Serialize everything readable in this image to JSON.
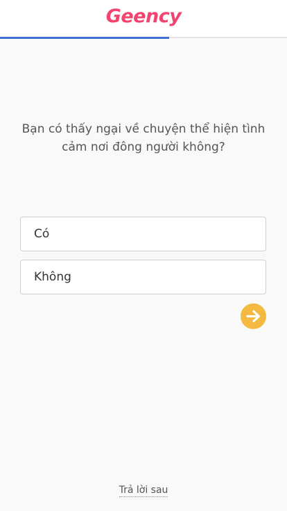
{
  "header": {
    "logo_text": "Geency",
    "progress_fraction": 0.59
  },
  "question": {
    "text": "Bạn có thấy ngại về chuyện thể hiện tình cảm nơi đông người không?"
  },
  "options": [
    {
      "label": "Có"
    },
    {
      "label": "Không"
    }
  ],
  "next_button": {
    "icon": "arrow-right-icon"
  },
  "footer": {
    "answer_later_label": "Trả lời sau"
  },
  "colors": {
    "brand": "#f2446f",
    "progress": "#3f6fd1",
    "accent": "#f4b941"
  }
}
